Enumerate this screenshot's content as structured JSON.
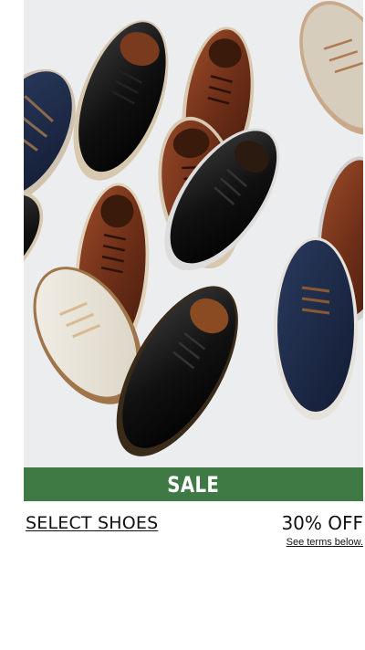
{
  "promo": {
    "banner_label": "SALE",
    "category_link": "SELECT SHOES",
    "offer": "30% OFF",
    "terms_link": "See terms below."
  },
  "colors": {
    "banner_green": "#3f7a45",
    "hero_background": "#ecedef"
  }
}
